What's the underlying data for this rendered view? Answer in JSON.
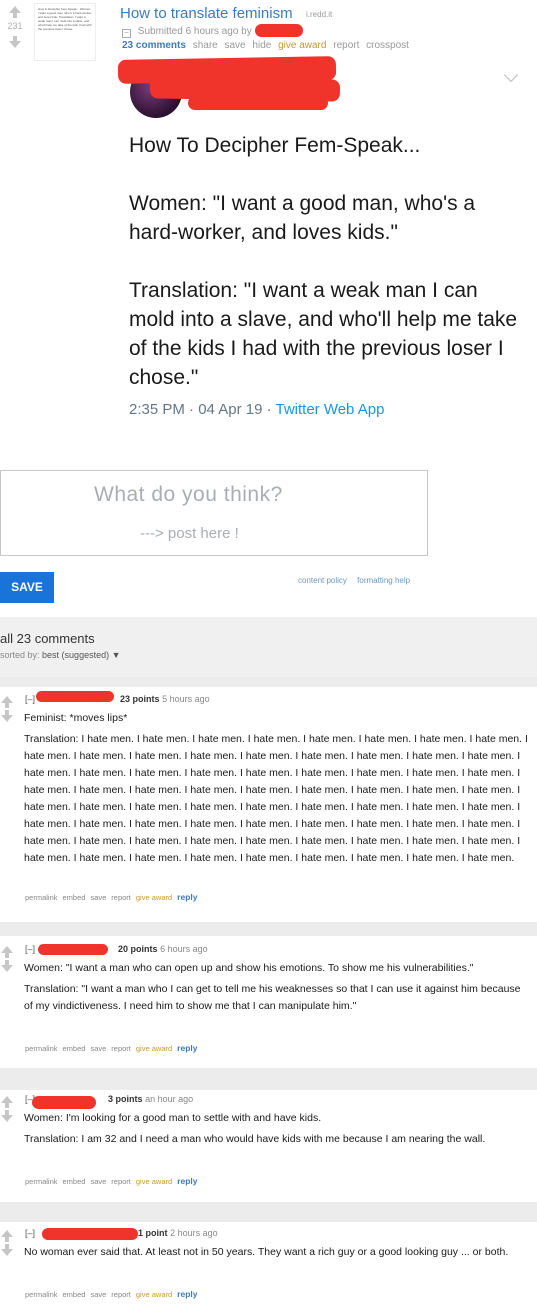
{
  "post": {
    "score": "231",
    "title": "How to translate feminism",
    "domain": "i.redd.it",
    "meta": "Submitted 6 hours ago by",
    "comments_label": "23 comments",
    "actions": [
      "share",
      "save",
      "hide",
      "give award",
      "report",
      "crosspost"
    ],
    "thumb_text": "How to Decipher Fem-Speak... Women: I want a good man, who's a hard-worker, and loves kids. Translation: I want a weak man I can mold into a slave, and who'll help me take of the kids I had with the previous loser I chose."
  },
  "tweet": {
    "text": "How To Decipher Fem-Speak...\n\nWomen: \"I want a good man, who's a hard-worker, and loves kids.\"\n\nTranslation: \"I want a weak man I can mold into a slave, and who'll help me take of the kids I had with the previous loser I chose.\"",
    "time": "2:35 PM · 04 Apr 19 · ",
    "source": "Twitter Web App"
  },
  "comment_form": {
    "prompt": "What do you think?",
    "sub": "---> post here !",
    "save_label": "SAVE",
    "content_policy": "content policy",
    "formatting_help": "formatting help"
  },
  "comments_header": {
    "count": "all 23 comments",
    "sorted_label": "sorted by:",
    "sorted_value": "best (suggested) ▼"
  },
  "comments": [
    {
      "collapse": "[–]",
      "points": "23 points",
      "age": "5 hours ago",
      "body": [
        "Feminist: *moves lips*",
        "Translation: I hate men. I hate men. I hate men. I hate men. I hate men. I hate men. I hate men. I hate men. I hate men. I hate men. I hate men. I hate men. I hate men. I hate men. I hate men. I hate men. I hate men. I hate men. I hate men. I hate men. I hate men. I hate men. I hate men. I hate men. I hate men. I hate men. I hate men. I hate men. I hate men. I hate men. I hate men. I hate men. I hate men. I hate men. I hate men. I hate men. I hate men. I hate men. I hate men. I hate men. I hate men. I hate men. I hate men. I hate men. I hate men. I hate men. I hate men. I hate men. I hate men. I hate men. I hate men. I hate men. I hate men. I hate men. I hate men. I hate men. I hate men. I hate men. I hate men. I hate men. I hate men. I hate men. I hate men. I hate men. I hate men. I hate men. I hate men. I hate men. I hate men. I hate men. I hate men."
      ]
    },
    {
      "collapse": "[–]",
      "points": "20 points",
      "age": "6 hours ago",
      "body": [
        "Women: \"I want a man who can open up and show his emotions. To show me his vulnerabilities.\"",
        "Translation: \"I want a man who I can get to tell me his weaknesses so that I can use it against him because of my vindictiveness. I need him to show me that I can manipulate him.\""
      ]
    },
    {
      "collapse": "[–]",
      "points": "3 points",
      "age": "an hour ago",
      "body": [
        "Women: I'm looking for a good man to settle with and have kids.",
        "Translation: I am 32 and I need a man who would have kids with me because I am nearing the wall."
      ]
    },
    {
      "collapse": "[–]",
      "points": "1 point",
      "age": "2 hours ago",
      "body": [
        "No woman ever said that. At least not in 50 years. They want a rich guy or a good looking guy ... or both."
      ]
    }
  ],
  "comment_links": [
    "permalink",
    "embed",
    "save",
    "report",
    "give award",
    "reply"
  ]
}
